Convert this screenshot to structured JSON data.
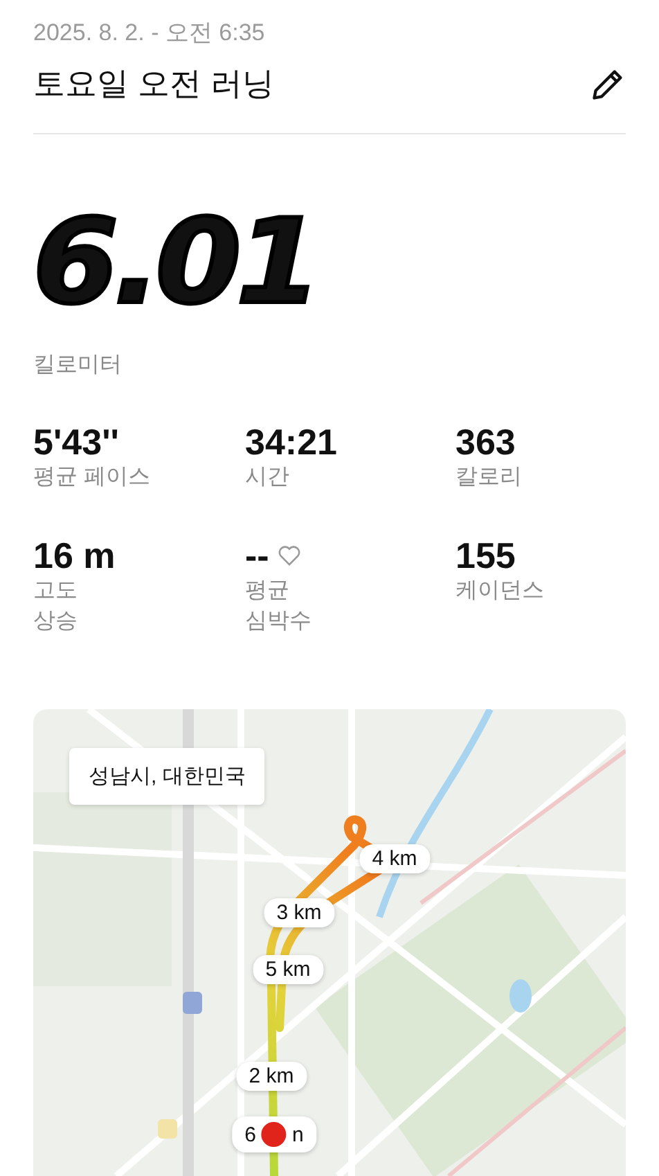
{
  "header": {
    "datetime": "2025. 8. 2. - 오전 6:35",
    "title": "토요일 오전 러닝"
  },
  "distance": {
    "value": "6.01",
    "unit": "킬로미터"
  },
  "stats": [
    {
      "kind": "plain",
      "value": "5'43''",
      "label_lines": [
        "평균 페이스"
      ]
    },
    {
      "kind": "plain",
      "value": "34:21",
      "label_lines": [
        "시간"
      ]
    },
    {
      "kind": "plain",
      "value": "363",
      "label_lines": [
        "칼로리"
      ]
    },
    {
      "kind": "plain",
      "value": "16 m",
      "label_lines": [
        "고도",
        "상승"
      ]
    },
    {
      "kind": "heart_rate",
      "value": "--",
      "label_lines": [
        "평균",
        "심박수"
      ]
    },
    {
      "kind": "plain",
      "value": "155",
      "label_lines": [
        "케이던스"
      ]
    }
  ],
  "map": {
    "location": "성남시, 대한민국",
    "markers": [
      {
        "label": "4 km"
      },
      {
        "label": "3 km"
      },
      {
        "label": "5 km"
      },
      {
        "label": "2 km"
      },
      {
        "label": "6",
        "tail": "n"
      }
    ]
  }
}
